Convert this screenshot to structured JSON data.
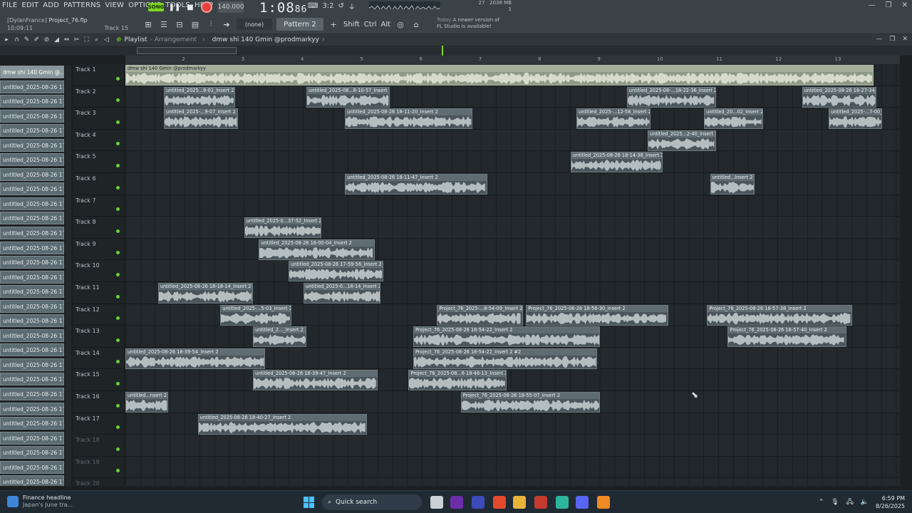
{
  "menu": [
    "FILE",
    "EDIT",
    "ADD",
    "PATTERNS",
    "VIEW",
    "OPTIONS",
    "TOOLS",
    "HELP"
  ],
  "project": {
    "user": "[DylanFrance]",
    "file": "Project_76.flp",
    "elapsed": "10:09:11",
    "hint_track": "Track 15"
  },
  "transport": {
    "mode": "SONG",
    "tempo": "140.000",
    "time_main": "1:08",
    "time_sub": "86",
    "time_sig": "3:2",
    "cpu_mem": "2038 MB",
    "cpu_val": "27",
    "cpu_val2": "1"
  },
  "pattern": {
    "none_label": "(none)",
    "current": "Pattern 2",
    "mod_shift": "Shift",
    "mod_ctrl": "Ctrl",
    "mod_alt": "Alt"
  },
  "news_banner": {
    "day": "Today",
    "line1": "A newer version of",
    "line2": "FL Studio is available!"
  },
  "playlist": {
    "title": "Playlist",
    "subtitle": "- Arrangement",
    "arrangement_name": "dmw shi 140 Gmin @prodmarkyy"
  },
  "ruler": [
    "2",
    "3",
    "4",
    "5",
    "6",
    "7",
    "8",
    "9",
    "10",
    "11",
    "12",
    "13"
  ],
  "picker_items": [
    "dmw shi 140 Gmin @...",
    "untitled_2025-08-26 17-...",
    "untitled_2025-08-26 17-...",
    "untitled_2025-08-26 17-...",
    "untitled_2025-08-26 17-...",
    "untitled_2025-08-26 17-...",
    "untitled_2025-08-26 17-...",
    "untitled_2025-08-26 17-...",
    "untitled_2025-08-26 17-...",
    "untitled_2025-08-26 17-...",
    "untitled_2025-08-26 17-...",
    "untitled_2025-08-26 17-...",
    "untitled_2025-08-26 17-...",
    "untitled_2025-08-26 17-...",
    "untitled_2025-08-26 17-...",
    "untitled_2025-08-26 17-...",
    "untitled_2025-08-26 17-...",
    "untitled_2025-08-26 17-...",
    "untitled_2025-08-26 17-...",
    "untitled_2025-08-26 17-...",
    "untitled_2025-08-26 17-...",
    "untitled_2025-08-26 17-...",
    "untitled_2025-08-26 17-...",
    "untitled_2025-08-26 17-...",
    "untitled_2025-08-26 17-...",
    "untitled_2025-08-26 17-...",
    "untitled_2025-08-26 17-...",
    "untitled_2025-08-26 17-...",
    "untitled_2025-08-26 17-..."
  ],
  "tracks": [
    "Track 1",
    "Track 2",
    "Track 3",
    "Track 4",
    "Track 5",
    "Track 6",
    "Track 7",
    "Track 8",
    "Track 9",
    "Track 10",
    "Track 11",
    "Track 12",
    "Track 13",
    "Track 14",
    "Track 15",
    "Track 16",
    "Track 17",
    "Track 18",
    "Track 19",
    "Track 20"
  ],
  "clips": [
    {
      "track": 1,
      "start": 0,
      "len": 12.6,
      "label": "dmw shi 140 Gmin @prodmarkyy",
      "master": true
    },
    {
      "track": 2,
      "start": 0.65,
      "len": 1.2,
      "label": "untitled_2025...9-01_Insert 2"
    },
    {
      "track": 2,
      "start": 3.05,
      "len": 1.4,
      "label": "untitled_2025-08...8-10-57_Insert 2"
    },
    {
      "track": 2,
      "start": 8.45,
      "len": 1.5,
      "label": "untitled_2025-08-...18-22-36_Insert 2"
    },
    {
      "track": 2,
      "start": 11.4,
      "len": 1.25,
      "label": "untitled_2025-08-26 18-27-34_Insert 2"
    },
    {
      "track": 3,
      "start": 0.65,
      "len": 1.25,
      "label": "untitled_2025-...9-07_Insert 2"
    },
    {
      "track": 3,
      "start": 3.7,
      "len": 2.15,
      "label": "untitled_2025-08-26 18-11-20_Insert 2"
    },
    {
      "track": 3,
      "start": 7.6,
      "len": 1.25,
      "label": "untitled_2025-...12-58_Insert 2"
    },
    {
      "track": 3,
      "start": 9.75,
      "len": 1.0,
      "label": "untitled_20...02_Insert 2"
    },
    {
      "track": 3,
      "start": 11.85,
      "len": 0.9,
      "label": "untitled_2025-...7-00_Insert 2"
    },
    {
      "track": 4,
      "start": 8.8,
      "len": 1.15,
      "label": "untitled_2025...2-40_Insert 2"
    },
    {
      "track": 5,
      "start": 7.5,
      "len": 1.55,
      "label": "untitled_2025-08-26 18-14-38_Insert 2"
    },
    {
      "track": 6,
      "start": 3.7,
      "len": 2.4,
      "label": "untitled_2025-08-26 18-11-47_Insert 2"
    },
    {
      "track": 6,
      "start": 9.85,
      "len": 0.75,
      "label": "untitled...Insert 2"
    },
    {
      "track": 8,
      "start": 2.0,
      "len": 1.3,
      "label": "untitled_2025-0...37-52_Insert 2"
    },
    {
      "track": 9,
      "start": 2.25,
      "len": 1.95,
      "label": "untitled_2025-08-26 18-00-04_Insert 2"
    },
    {
      "track": 10,
      "start": 2.75,
      "len": 1.6,
      "label": "untitled_2025-08-26 17-59-56_Insert 2"
    },
    {
      "track": 11,
      "start": 0.55,
      "len": 1.6,
      "label": "untitled_2025-08-26 18-18-14_Insert 2"
    },
    {
      "track": 11,
      "start": 3.0,
      "len": 1.3,
      "label": "untitled_2025-0...18-14_Insert 2"
    },
    {
      "track": 12,
      "start": 1.6,
      "len": 1.2,
      "label": "untitled_2025-...5-03_Insert 2"
    },
    {
      "track": 12,
      "start": 5.25,
      "len": 1.45,
      "label": "Project_76_2025-...8-54-09_Insert 2"
    },
    {
      "track": 12,
      "start": 6.75,
      "len": 2.4,
      "label": "Project_76_2025-08-26 18-56-30_Insert 2"
    },
    {
      "track": 12,
      "start": 9.8,
      "len": 2.45,
      "label": "Project_76_2025-08-26 18-57-38_Insert 2"
    },
    {
      "track": 13,
      "start": 2.15,
      "len": 0.9,
      "label": "untitled_2..._Insert 2"
    },
    {
      "track": 13,
      "start": 4.85,
      "len": 3.15,
      "label": "Project_76_2025-08-26 18-54-22_Insert 2"
    },
    {
      "track": 13,
      "start": 10.15,
      "len": 2.0,
      "label": "Project_76_2025-08-26 18-57-40_Insert 2"
    },
    {
      "track": 14,
      "start": 0.0,
      "len": 2.35,
      "label": "untitled_2025-08-26 18-39-54_Insert 2"
    },
    {
      "track": 14,
      "start": 4.85,
      "len": 3.1,
      "label": "Project_76_2025-08-26 18-54-22_Insert 2 #2"
    },
    {
      "track": 15,
      "start": 2.15,
      "len": 2.1,
      "label": "untitled_2025-08-26 18-39-47_Insert 2"
    },
    {
      "track": 15,
      "start": 4.77,
      "len": 1.65,
      "label": "Project_76_2025-08...6 18-46-13_Insert 2"
    },
    {
      "track": 16,
      "start": 0.0,
      "len": 0.72,
      "label": "untitled...nsert 2"
    },
    {
      "track": 16,
      "start": 5.65,
      "len": 2.35,
      "label": "Project_76_2025-08-26 18-55-07_Insert 2"
    },
    {
      "track": 17,
      "start": 1.22,
      "len": 2.85,
      "label": "untitled_2025-08-26 18-40-27_Insert 2"
    }
  ],
  "taskbar": {
    "news_title": "Finance headline",
    "news_sub": "Japan's June tra...",
    "search": "Quick search",
    "time": "6:59 PM",
    "date": "8/26/2025"
  }
}
